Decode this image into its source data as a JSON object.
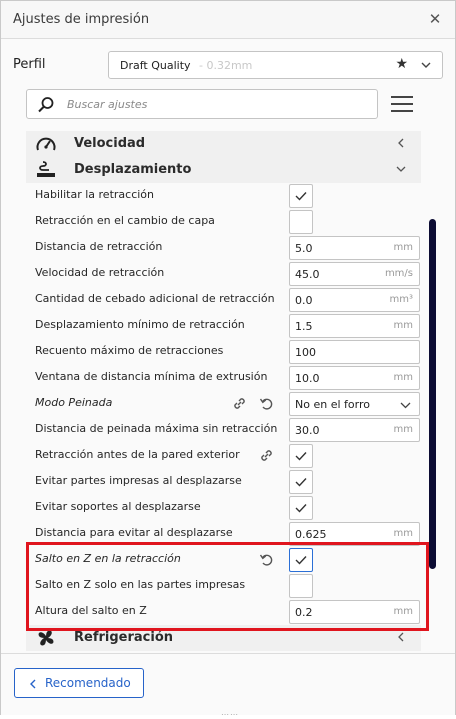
{
  "window": {
    "title": "Ajustes de impresión",
    "close_icon": "close-icon"
  },
  "profile": {
    "label": "Perfil",
    "value": "Draft Quality",
    "sub": "- 0.32mm"
  },
  "search": {
    "placeholder": "Buscar ajustes"
  },
  "categories": {
    "velocidad": {
      "label": "Velocidad",
      "icon": "speedometer-icon"
    },
    "desplazamiento": {
      "label": "Desplazamiento",
      "icon": "travel-icon"
    },
    "refrigeracion": {
      "label": "Refrigeración",
      "icon": "fan-icon"
    }
  },
  "rows": [
    {
      "label": "Habilitar la retracción",
      "type": "checkbox",
      "checked": true
    },
    {
      "label": "Retracción en el cambio de capa",
      "type": "checkbox",
      "checked": false
    },
    {
      "label": "Distancia de retracción",
      "type": "field",
      "value": "5.0",
      "unit": "mm"
    },
    {
      "label": "Velocidad de retracción",
      "type": "field",
      "value": "45.0",
      "unit": "mm/s"
    },
    {
      "label": "Cantidad de cebado adicional de retracción",
      "type": "field",
      "value": "0.0",
      "unit": "mm³"
    },
    {
      "label": "Desplazamiento mínimo de retracción",
      "type": "field",
      "value": "1.5",
      "unit": "mm"
    },
    {
      "label": "Recuento máximo de retracciones",
      "type": "field",
      "value": "100",
      "unit": ""
    },
    {
      "label": "Ventana de distancia mínima de extrusión",
      "type": "field",
      "value": "10.0",
      "unit": "mm"
    },
    {
      "label": "Modo Peinada",
      "type": "select",
      "value": "No en el forro"
    },
    {
      "label": "Distancia de peinada máxima sin retracción",
      "type": "field",
      "value": "30.0",
      "unit": "mm"
    },
    {
      "label": "Retracción antes de la pared exterior",
      "type": "checkbox",
      "checked": true
    },
    {
      "label": "Evitar partes impresas al desplazarse",
      "type": "checkbox",
      "checked": true
    },
    {
      "label": "Evitar soportes al desplazarse",
      "type": "checkbox",
      "checked": true
    },
    {
      "label": "Distancia para evitar al desplazarse",
      "type": "field",
      "value": "0.625",
      "unit": "mm"
    },
    {
      "label": "Salto en Z en la retracción",
      "type": "checkbox",
      "checked": true
    },
    {
      "label": "Salto en Z solo en las partes impresas",
      "type": "checkbox",
      "checked": false
    },
    {
      "label": "Altura del salto en Z",
      "type": "field",
      "value": "0.2",
      "unit": "mm"
    }
  ],
  "footer": {
    "recommended_label": "Recomendado"
  },
  "colors": {
    "accent": "#2763c9",
    "highlight": "#e0151e",
    "scrollbar": "#0c0c33"
  }
}
